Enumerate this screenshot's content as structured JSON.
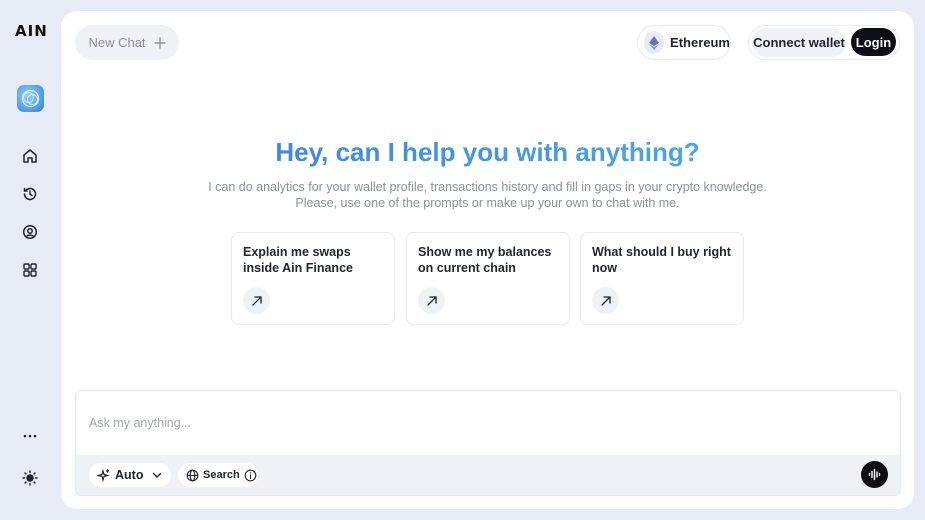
{
  "brand": {
    "logo_text": "AIN"
  },
  "sidebar": {
    "items": [
      {
        "icon": "home-icon"
      },
      {
        "icon": "history-icon"
      },
      {
        "icon": "profile-icon"
      },
      {
        "icon": "apps-grid-icon"
      }
    ],
    "bottom": [
      {
        "icon": "more-icon"
      },
      {
        "icon": "theme-sun-icon"
      }
    ]
  },
  "header": {
    "new_chat_label": "New Chat",
    "chain_label": "Ethereum",
    "connect_wallet_label": "Connect wallet",
    "login_label": "Login"
  },
  "hero": {
    "title": "Hey, can I help you with anything?",
    "subtitle_line1": "I can do analytics for your wallet profile, transactions history and fill in gaps in your crypto knowledge.",
    "subtitle_line2": "Please, use one of the prompts or make up your own to chat with me."
  },
  "prompts": [
    {
      "text": "Explain me swaps inside Ain Finance"
    },
    {
      "text": "Show me my balances on current chain"
    },
    {
      "text": "What should I buy right now"
    }
  ],
  "composer": {
    "placeholder": "Ask my anything...",
    "mode_label": "Auto",
    "search_label": "Search"
  },
  "colors": {
    "accent_gradient_start": "#3a78e0",
    "accent_gradient_end": "#4fb5e8",
    "dark_button": "#0d0f14",
    "background": "#e6ebf5"
  }
}
